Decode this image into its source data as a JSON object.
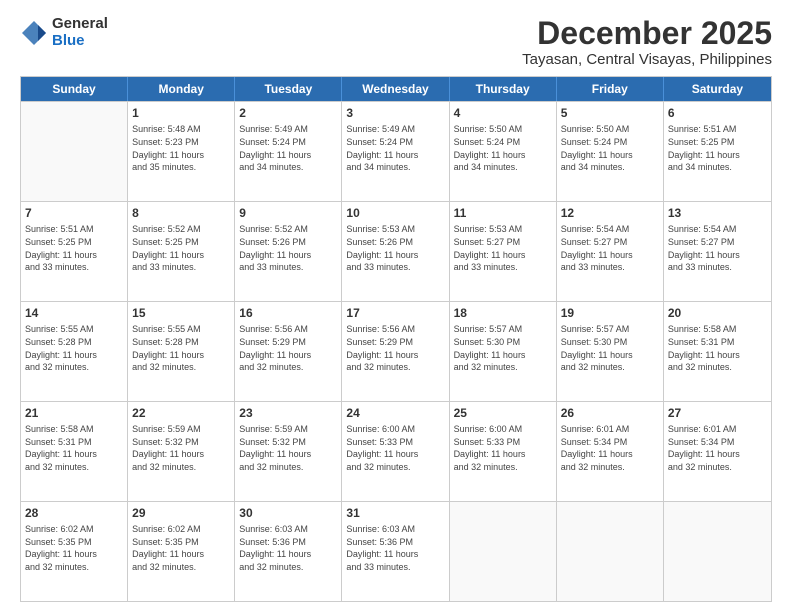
{
  "logo": {
    "general": "General",
    "blue": "Blue"
  },
  "title": "December 2025",
  "subtitle": "Tayasan, Central Visayas, Philippines",
  "header_days": [
    "Sunday",
    "Monday",
    "Tuesday",
    "Wednesday",
    "Thursday",
    "Friday",
    "Saturday"
  ],
  "weeks": [
    [
      {
        "day": "",
        "info": ""
      },
      {
        "day": "1",
        "info": "Sunrise: 5:48 AM\nSunset: 5:23 PM\nDaylight: 11 hours\nand 35 minutes."
      },
      {
        "day": "2",
        "info": "Sunrise: 5:49 AM\nSunset: 5:24 PM\nDaylight: 11 hours\nand 34 minutes."
      },
      {
        "day": "3",
        "info": "Sunrise: 5:49 AM\nSunset: 5:24 PM\nDaylight: 11 hours\nand 34 minutes."
      },
      {
        "day": "4",
        "info": "Sunrise: 5:50 AM\nSunset: 5:24 PM\nDaylight: 11 hours\nand 34 minutes."
      },
      {
        "day": "5",
        "info": "Sunrise: 5:50 AM\nSunset: 5:24 PM\nDaylight: 11 hours\nand 34 minutes."
      },
      {
        "day": "6",
        "info": "Sunrise: 5:51 AM\nSunset: 5:25 PM\nDaylight: 11 hours\nand 34 minutes."
      }
    ],
    [
      {
        "day": "7",
        "info": "Sunrise: 5:51 AM\nSunset: 5:25 PM\nDaylight: 11 hours\nand 33 minutes."
      },
      {
        "day": "8",
        "info": "Sunrise: 5:52 AM\nSunset: 5:25 PM\nDaylight: 11 hours\nand 33 minutes."
      },
      {
        "day": "9",
        "info": "Sunrise: 5:52 AM\nSunset: 5:26 PM\nDaylight: 11 hours\nand 33 minutes."
      },
      {
        "day": "10",
        "info": "Sunrise: 5:53 AM\nSunset: 5:26 PM\nDaylight: 11 hours\nand 33 minutes."
      },
      {
        "day": "11",
        "info": "Sunrise: 5:53 AM\nSunset: 5:27 PM\nDaylight: 11 hours\nand 33 minutes."
      },
      {
        "day": "12",
        "info": "Sunrise: 5:54 AM\nSunset: 5:27 PM\nDaylight: 11 hours\nand 33 minutes."
      },
      {
        "day": "13",
        "info": "Sunrise: 5:54 AM\nSunset: 5:27 PM\nDaylight: 11 hours\nand 33 minutes."
      }
    ],
    [
      {
        "day": "14",
        "info": "Sunrise: 5:55 AM\nSunset: 5:28 PM\nDaylight: 11 hours\nand 32 minutes."
      },
      {
        "day": "15",
        "info": "Sunrise: 5:55 AM\nSunset: 5:28 PM\nDaylight: 11 hours\nand 32 minutes."
      },
      {
        "day": "16",
        "info": "Sunrise: 5:56 AM\nSunset: 5:29 PM\nDaylight: 11 hours\nand 32 minutes."
      },
      {
        "day": "17",
        "info": "Sunrise: 5:56 AM\nSunset: 5:29 PM\nDaylight: 11 hours\nand 32 minutes."
      },
      {
        "day": "18",
        "info": "Sunrise: 5:57 AM\nSunset: 5:30 PM\nDaylight: 11 hours\nand 32 minutes."
      },
      {
        "day": "19",
        "info": "Sunrise: 5:57 AM\nSunset: 5:30 PM\nDaylight: 11 hours\nand 32 minutes."
      },
      {
        "day": "20",
        "info": "Sunrise: 5:58 AM\nSunset: 5:31 PM\nDaylight: 11 hours\nand 32 minutes."
      }
    ],
    [
      {
        "day": "21",
        "info": "Sunrise: 5:58 AM\nSunset: 5:31 PM\nDaylight: 11 hours\nand 32 minutes."
      },
      {
        "day": "22",
        "info": "Sunrise: 5:59 AM\nSunset: 5:32 PM\nDaylight: 11 hours\nand 32 minutes."
      },
      {
        "day": "23",
        "info": "Sunrise: 5:59 AM\nSunset: 5:32 PM\nDaylight: 11 hours\nand 32 minutes."
      },
      {
        "day": "24",
        "info": "Sunrise: 6:00 AM\nSunset: 5:33 PM\nDaylight: 11 hours\nand 32 minutes."
      },
      {
        "day": "25",
        "info": "Sunrise: 6:00 AM\nSunset: 5:33 PM\nDaylight: 11 hours\nand 32 minutes."
      },
      {
        "day": "26",
        "info": "Sunrise: 6:01 AM\nSunset: 5:34 PM\nDaylight: 11 hours\nand 32 minutes."
      },
      {
        "day": "27",
        "info": "Sunrise: 6:01 AM\nSunset: 5:34 PM\nDaylight: 11 hours\nand 32 minutes."
      }
    ],
    [
      {
        "day": "28",
        "info": "Sunrise: 6:02 AM\nSunset: 5:35 PM\nDaylight: 11 hours\nand 32 minutes."
      },
      {
        "day": "29",
        "info": "Sunrise: 6:02 AM\nSunset: 5:35 PM\nDaylight: 11 hours\nand 32 minutes."
      },
      {
        "day": "30",
        "info": "Sunrise: 6:03 AM\nSunset: 5:36 PM\nDaylight: 11 hours\nand 32 minutes."
      },
      {
        "day": "31",
        "info": "Sunrise: 6:03 AM\nSunset: 5:36 PM\nDaylight: 11 hours\nand 33 minutes."
      },
      {
        "day": "",
        "info": ""
      },
      {
        "day": "",
        "info": ""
      },
      {
        "day": "",
        "info": ""
      }
    ]
  ]
}
